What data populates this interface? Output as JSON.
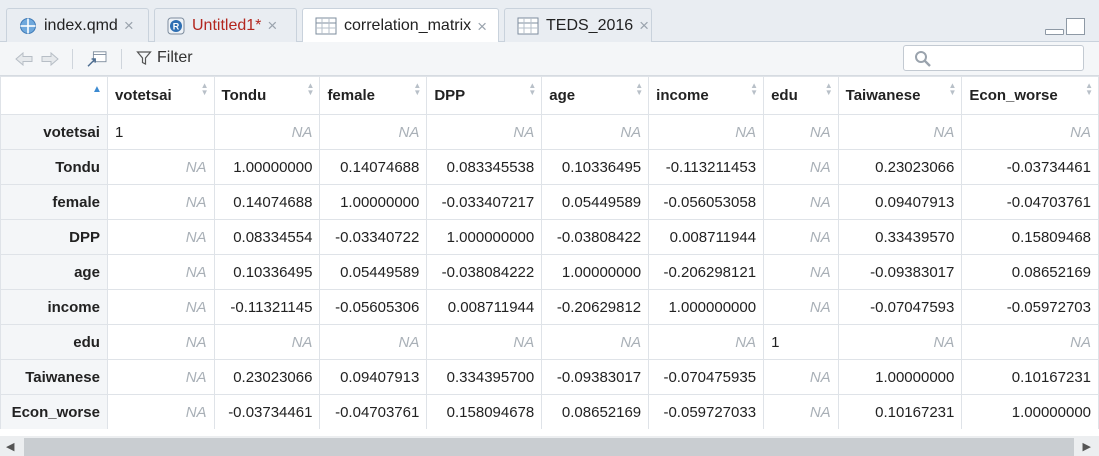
{
  "tabs": [
    {
      "label": "index.qmd",
      "icon": "quarto-document-icon",
      "unsaved": false,
      "active": false
    },
    {
      "label": "Untitled1*",
      "icon": "r-script-icon",
      "unsaved": true,
      "active": false
    },
    {
      "label": "correlation_matrix",
      "icon": "data-table-icon",
      "unsaved": false,
      "active": true
    },
    {
      "label": "TEDS_2016",
      "icon": "data-table-icon",
      "unsaved": false,
      "active": false
    }
  ],
  "toolbar": {
    "filter_label": "Filter",
    "search_placeholder": ""
  },
  "grid": {
    "columns": [
      "",
      "votetsai",
      "Tondu",
      "female",
      "DPP",
      "age",
      "income",
      "edu",
      "Taiwanese",
      "Econ_worse"
    ],
    "rows": [
      {
        "name": "votetsai",
        "cells": [
          "1",
          "NA",
          "NA",
          "NA",
          "NA",
          "NA",
          "NA",
          "NA",
          "NA"
        ]
      },
      {
        "name": "Tondu",
        "cells": [
          "NA",
          "1.00000000",
          "0.14074688",
          "0.083345538",
          "0.10336495",
          "-0.113211453",
          "NA",
          "0.23023066",
          "-0.03734461"
        ]
      },
      {
        "name": "female",
        "cells": [
          "NA",
          "0.14074688",
          "1.00000000",
          "-0.033407217",
          "0.05449589",
          "-0.056053058",
          "NA",
          "0.09407913",
          "-0.04703761"
        ]
      },
      {
        "name": "DPP",
        "cells": [
          "NA",
          "0.08334554",
          "-0.03340722",
          "1.000000000",
          "-0.03808422",
          "0.008711944",
          "NA",
          "0.33439570",
          "0.15809468"
        ]
      },
      {
        "name": "age",
        "cells": [
          "NA",
          "0.10336495",
          "0.05449589",
          "-0.038084222",
          "1.00000000",
          "-0.206298121",
          "NA",
          "-0.09383017",
          "0.08652169"
        ]
      },
      {
        "name": "income",
        "cells": [
          "NA",
          "-0.11321145",
          "-0.05605306",
          "0.008711944",
          "-0.20629812",
          "1.000000000",
          "NA",
          "-0.07047593",
          "-0.05972703"
        ]
      },
      {
        "name": "edu",
        "cells": [
          "NA",
          "NA",
          "NA",
          "NA",
          "NA",
          "NA",
          "1",
          "NA",
          "NA"
        ]
      },
      {
        "name": "Taiwanese",
        "cells": [
          "NA",
          "0.23023066",
          "0.09407913",
          "0.334395700",
          "-0.09383017",
          "-0.070475935",
          "NA",
          "1.00000000",
          "0.10167231"
        ]
      },
      {
        "name": "Econ_worse",
        "cells": [
          "NA",
          "-0.03734461",
          "-0.04703761",
          "0.158094678",
          "0.08652169",
          "-0.059727033",
          "NA",
          "0.10167231",
          "1.00000000"
        ]
      }
    ]
  },
  "colors": {
    "unsaved_tab": "#b3261e",
    "sort_active": "#3c8ad1",
    "na_text": "#a9b0b7"
  }
}
